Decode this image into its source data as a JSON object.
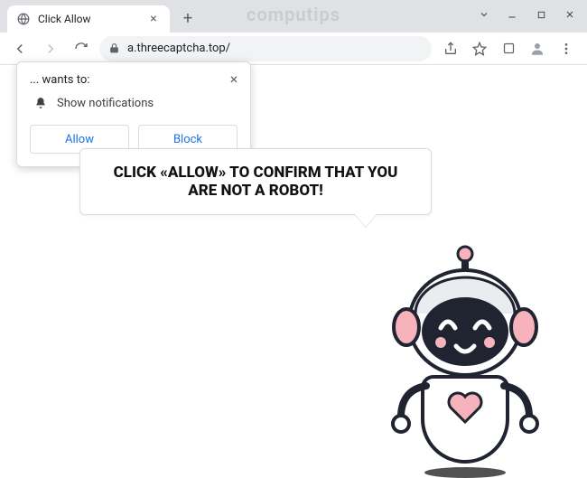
{
  "watermark": "computips",
  "tab": {
    "title": "Click Allow"
  },
  "omnibox": {
    "url": "a.threecaptcha.top/"
  },
  "prompt": {
    "wants_to": "... wants to:",
    "permission_label": "Show notifications",
    "allow": "Allow",
    "block": "Block"
  },
  "page": {
    "headline": "CLICK «ALLOW» TO CONFIRM THAT YOU ARE NOT A ROBOT!"
  }
}
